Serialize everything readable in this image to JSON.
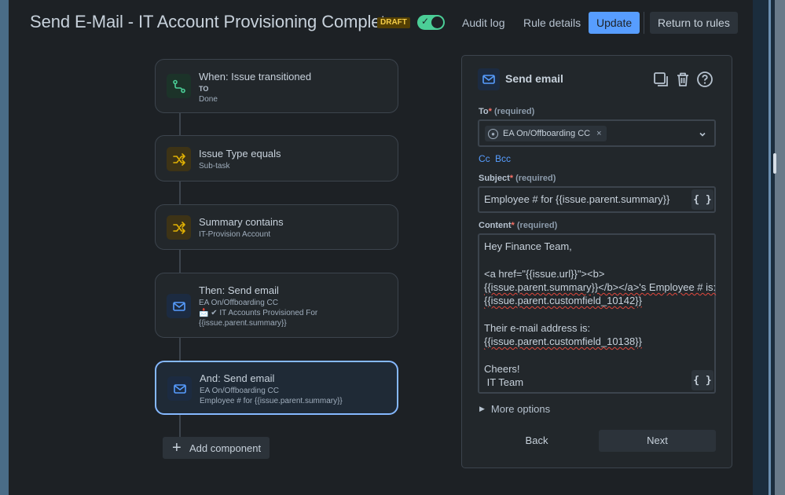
{
  "header": {
    "title": "Send E-Mail - IT Account Provisioning Complete",
    "status_badge": "DRAFT",
    "toggle_enabled": true,
    "audit_log": "Audit log",
    "rule_details": "Rule details",
    "update": "Update",
    "return_to_rules": "Return to rules"
  },
  "flow": {
    "nodes": [
      {
        "title": "When: Issue transitioned",
        "sub1": "TO",
        "sub2": "Done",
        "icon": "transition-icon"
      },
      {
        "title": "Issue Type equals",
        "sub1": "Sub-task",
        "icon": "shuffle-icon"
      },
      {
        "title": "Summary contains",
        "sub1": "IT-Provision Account",
        "icon": "shuffle-icon"
      },
      {
        "title": "Then: Send email",
        "sub1": "EA On/Offboarding CC",
        "sub2": "📩 ✔ IT Accounts Provisioned For",
        "sub3": "{{issue.parent.summary}}",
        "icon": "email-icon"
      },
      {
        "title": "And: Send email",
        "sub1": "EA On/Offboarding CC",
        "sub2": "Employee # for {{issue.parent.summary}}",
        "icon": "email-icon"
      }
    ],
    "add_component": "Add component"
  },
  "panel": {
    "title": "Send email",
    "to_label": "To",
    "required_text": "(required)",
    "to_chip": "EA On/Offboarding CC",
    "cc": "Cc",
    "bcc": "Bcc",
    "subject_label": "Subject",
    "subject_value": "Employee # for {{issue.parent.summary}}",
    "content_label": "Content",
    "content_lines": {
      "l1": "Hey Finance Team,",
      "l3": "<a href=\"{{issue.url}}\"><b>",
      "l4": "{{issue.parent.summary}}</b></a>'s Employee # is:",
      "l5": "{{issue.parent.customfield_10142}}",
      "l7": "Their e-mail address is:",
      "l8": "{{issue.parent.customfield_10138}}",
      "l10": "Cheers!",
      "l11": " IT Team"
    },
    "brace_label": "{ }",
    "more_options": "More options",
    "back": "Back",
    "next": "Next"
  },
  "colors": {
    "background": "#1d2125",
    "accent": "#579dff",
    "toggle_on": "#4bce97",
    "draft_badge": "#f5cd47"
  }
}
